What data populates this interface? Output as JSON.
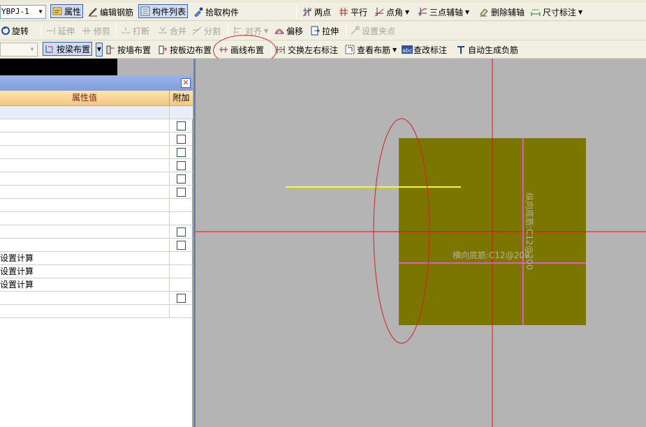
{
  "toolbar": {
    "row1": {
      "combo_value": "YBPJ-1",
      "properties": "属性",
      "edit_rebar": "编辑钢筋",
      "component_list": "构件列表",
      "pick_component": "拾取构件",
      "two_points": "两点",
      "parallel": "平行",
      "point_angle": "点角",
      "three_point_axis": "三点辅轴",
      "delete_axis": "删除辅轴",
      "dimension": "尺寸标注"
    },
    "row2": {
      "rotate": "旋转",
      "extend": "延伸",
      "trim": "修剪",
      "break": "打断",
      "merge": "合并",
      "split": "分割",
      "align": "对齐",
      "offset": "偏移",
      "stretch": "拉伸",
      "set_grip": "设置夹点"
    },
    "row3": {
      "by_beam": "按梁布置",
      "by_wall": "按墙布置",
      "by_slab_edge": "按板边布置",
      "draw_line": "画线布置",
      "swap_label": "交换左右标注",
      "view_layout": "查看布筋",
      "check_label": "查改标注",
      "auto_negative": "自动生成负筋"
    }
  },
  "panel": {
    "header_value": "属性值",
    "header_extra": "附加",
    "rows": [
      {
        "value": "",
        "checkbox": false
      },
      {
        "value": "",
        "checkbox": true
      },
      {
        "value": "",
        "checkbox": true
      },
      {
        "value": "",
        "checkbox": true
      },
      {
        "value": "",
        "checkbox": true
      },
      {
        "value": "",
        "checkbox": true
      },
      {
        "value": "",
        "checkbox": true
      },
      {
        "value": "",
        "checkbox": false
      },
      {
        "value": "",
        "checkbox": false
      },
      {
        "value": "",
        "checkbox": true
      },
      {
        "value": "",
        "checkbox": true
      },
      {
        "value": "设置计算",
        "checkbox": false
      },
      {
        "value": "设置计算",
        "checkbox": false
      },
      {
        "value": "设置计算",
        "checkbox": false
      },
      {
        "value": "",
        "checkbox": true
      },
      {
        "value": "",
        "checkbox": false
      }
    ]
  },
  "canvas": {
    "slab_color": "#7a7600",
    "horizontal_rebar_label": "横向底筋:C12@200",
    "vertical_rebar_label": "纵向底筋:C12@200",
    "axis_color": "#e01010",
    "rebar_line_color": "#ff55ff",
    "preview_line_color": "#ffff00"
  }
}
